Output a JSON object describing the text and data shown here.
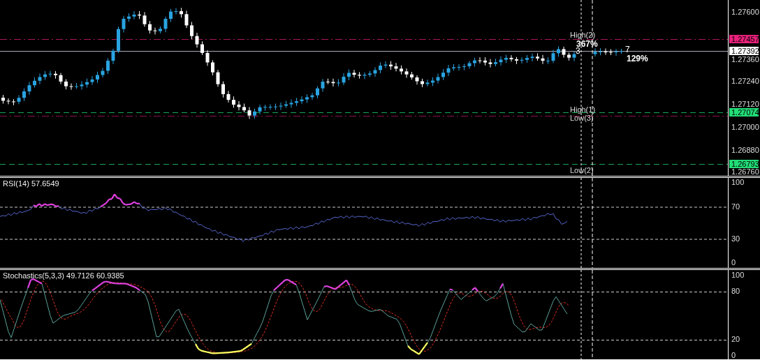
{
  "main_pane": {
    "axis_ticks": [
      "1.27600",
      "1.27360",
      "1.27240",
      "1.27120",
      "1.27000",
      "1.26880",
      "1.26760"
    ],
    "price_markers": [
      {
        "label": "1.27457",
        "color": "#e8207a"
      },
      {
        "label": "1.27392",
        "color": "#ffffff"
      },
      {
        "label": "1.27074",
        "color": "#22dd77"
      },
      {
        "label": "1.26793",
        "color": "#22dd77"
      }
    ],
    "annotations": [
      {
        "kind": "label",
        "text": "High(2)"
      },
      {
        "kind": "percent",
        "text": "367%"
      },
      {
        "kind": "count",
        "text": "3"
      },
      {
        "kind": "count",
        "text": "7"
      },
      {
        "kind": "percent",
        "text": "129%"
      },
      {
        "kind": "label",
        "text": "High(1)"
      },
      {
        "kind": "label",
        "text": "Low(3)"
      },
      {
        "kind": "label",
        "text": "Low(2)"
      }
    ]
  },
  "rsi_pane": {
    "title": "RSI(14) 57.6549",
    "axis_ticks": [
      "100",
      "70",
      "30",
      "0"
    ]
  },
  "stochastic_pane": {
    "title": "Stochastics(5,3,3) 49.7126 60.9385",
    "axis_ticks": [
      "100",
      "80",
      "20",
      "0"
    ]
  }
}
